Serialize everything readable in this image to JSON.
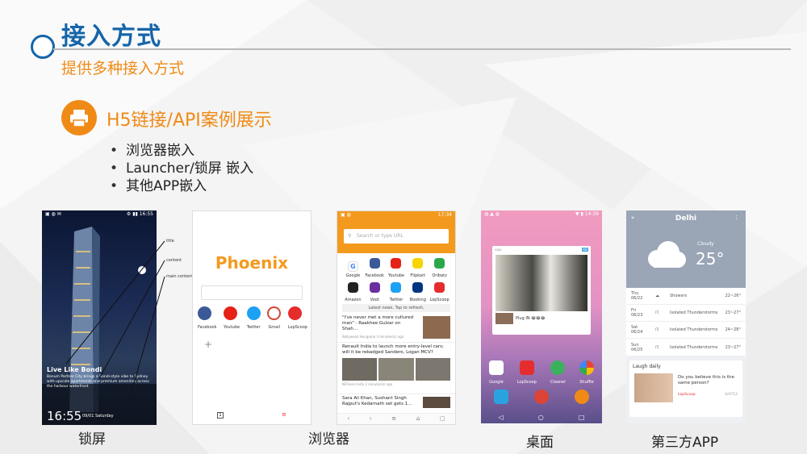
{
  "title": "接入方式",
  "subtitle": "提供多种接入方式",
  "section_heading": "H5链接/API案例展示",
  "bullets": [
    "浏览器嵌入",
    "Launcher/锁屏 嵌入",
    "其他APP嵌入"
  ],
  "captions": {
    "lockscreen": "锁屏",
    "browser": "浏览器",
    "desktop": "桌面",
    "thirdparty": "第三方APP"
  },
  "lockscreen": {
    "time": "16:55",
    "date": "09/01 Saturday",
    "headline": "Live Like Bondi",
    "body_text": "Bonum Partner City brings a Bondi-style vibe to Sydney with upscale apartments and premium amenities across the harbour waterfront",
    "callouts": [
      "title",
      "content",
      "main content"
    ]
  },
  "phoenix": {
    "logo": "Phoenix",
    "apps": [
      {
        "name": "Facebook",
        "icon": "facebook-icon",
        "color": "#3b5998"
      },
      {
        "name": "Youtube",
        "icon": "youtube-icon",
        "color": "#e62117"
      },
      {
        "name": "Twitter",
        "icon": "twitter-icon",
        "color": "#1da1f2"
      },
      {
        "name": "Gmail",
        "icon": "gmail-icon",
        "color": "#d44638"
      },
      {
        "name": "LopScoop",
        "icon": "lopscoop-icon",
        "color": "#e52d2d"
      }
    ],
    "add_label": "+",
    "tab_count": "1"
  },
  "browser": {
    "status_time": "17:34",
    "search_placeholder": "Search or type URL",
    "shortcuts": [
      {
        "name": "Google",
        "color": "#ffffff"
      },
      {
        "name": "Facebook",
        "color": "#3b5998"
      },
      {
        "name": "Youtube",
        "color": "#e62117"
      },
      {
        "name": "Flipkart",
        "color": "#f7d600"
      },
      {
        "name": "Oribatz",
        "color": "#2aa84a"
      },
      {
        "name": "Amazon",
        "color": "#222222"
      },
      {
        "name": "Voot",
        "color": "#6b2fa0"
      },
      {
        "name": "Twitter",
        "color": "#1da1f2"
      },
      {
        "name": "Booking",
        "color": "#003580"
      },
      {
        "name": "LopScoop",
        "color": "#e52d2d"
      }
    ],
    "refresh_bar": "Latest news. Tap to refresh.",
    "news": [
      {
        "title": "\"I've never met a more cultured man\" - Raakhee Gulzar on Shah...",
        "source": "Bollywood Hungama",
        "time": "3 minutes(s) ago"
      },
      {
        "title": "Renault India to launch more entry-level cars; will it be rebadged Sandero, Logan MCV?",
        "source": "NiTimes India",
        "time": "2 minutes(s) ago"
      },
      {
        "title": "Sara Ali Khan, Sushant Singh Rajput's Kedarnath set gets 1...",
        "source": "",
        "time": ""
      }
    ]
  },
  "desktop": {
    "status_time": "14:39",
    "ad_tag": "AD",
    "ad_caption": "Plug IN 😂😂😂",
    "apps": [
      {
        "name": "Google",
        "color": "#ffffff"
      },
      {
        "name": "LopScoop",
        "color": "#e52d2d"
      },
      {
        "name": "Cleaner",
        "color": "#3bb15d"
      },
      {
        "name": "Shuffle",
        "color": "#f4b400"
      }
    ],
    "dock_colors": [
      "#29a3e0",
      "#db4437",
      "#f08a16"
    ]
  },
  "weather": {
    "city": "Delhi",
    "condition": "Cloudy",
    "temp": "25°",
    "forecast": [
      {
        "day": "Thu",
        "date": "06/22",
        "desc": "Showers",
        "range": "22~26°"
      },
      {
        "day": "Fri",
        "date": "06/23",
        "desc": "Isolated Thunderstorms",
        "range": "23~27°"
      },
      {
        "day": "Sat",
        "date": "06/24",
        "desc": "Isolated Thunderstorms",
        "range": "24~28°"
      },
      {
        "day": "Sun",
        "date": "06/25",
        "desc": "Isolated Thunderstorms",
        "range": "23~27°"
      }
    ],
    "card_title": "Laugh daily",
    "card_text": "Do you believe this is the same person?",
    "card_source": "LopScoop",
    "card_meta": "4/4712"
  }
}
